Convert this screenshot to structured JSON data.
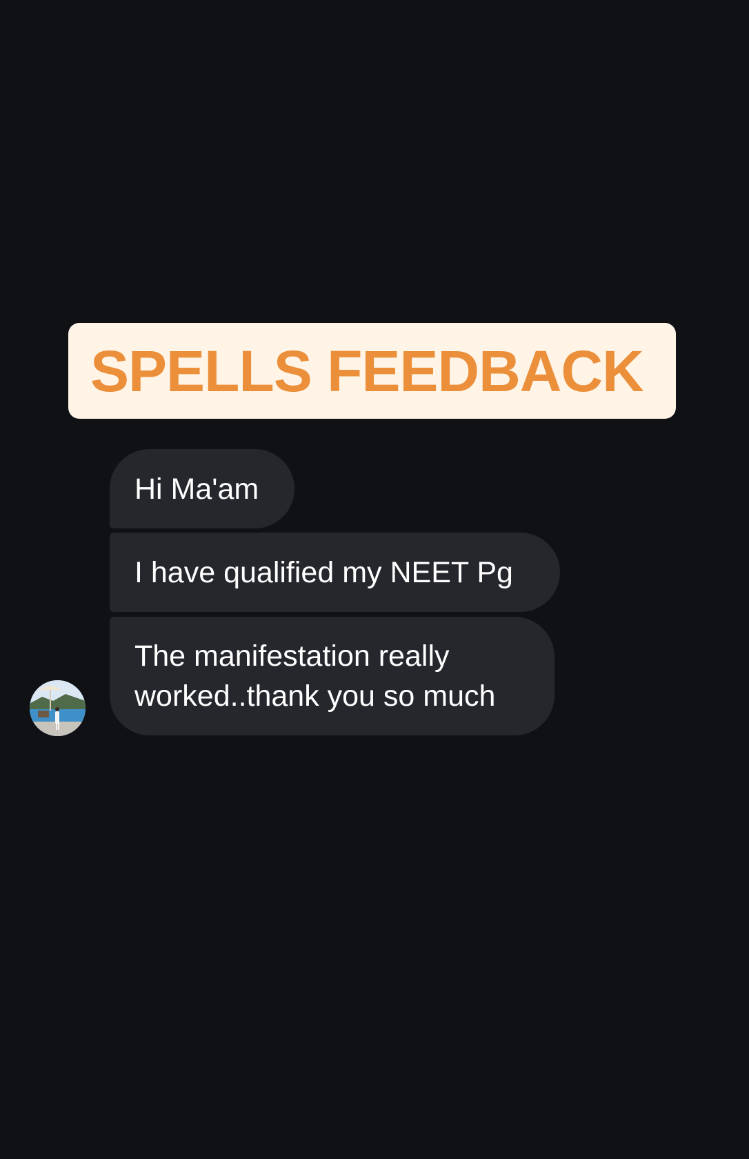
{
  "banner": {
    "title": "SPELLS FEEDBACK"
  },
  "messages": [
    {
      "lines": [
        "Hi Ma'am"
      ]
    },
    {
      "lines": [
        "I have qualified my NEET Pg"
      ]
    },
    {
      "lines": [
        "The manifestation really",
        "worked..thank you so much"
      ]
    }
  ],
  "colors": {
    "background": "#0f1115",
    "banner_bg": "#fff4e6",
    "banner_text": "#ec8f3b",
    "bubble_bg": "#25272d",
    "bubble_text": "#ffffff"
  },
  "avatar": {
    "icon": "profile-photo-avatar"
  }
}
